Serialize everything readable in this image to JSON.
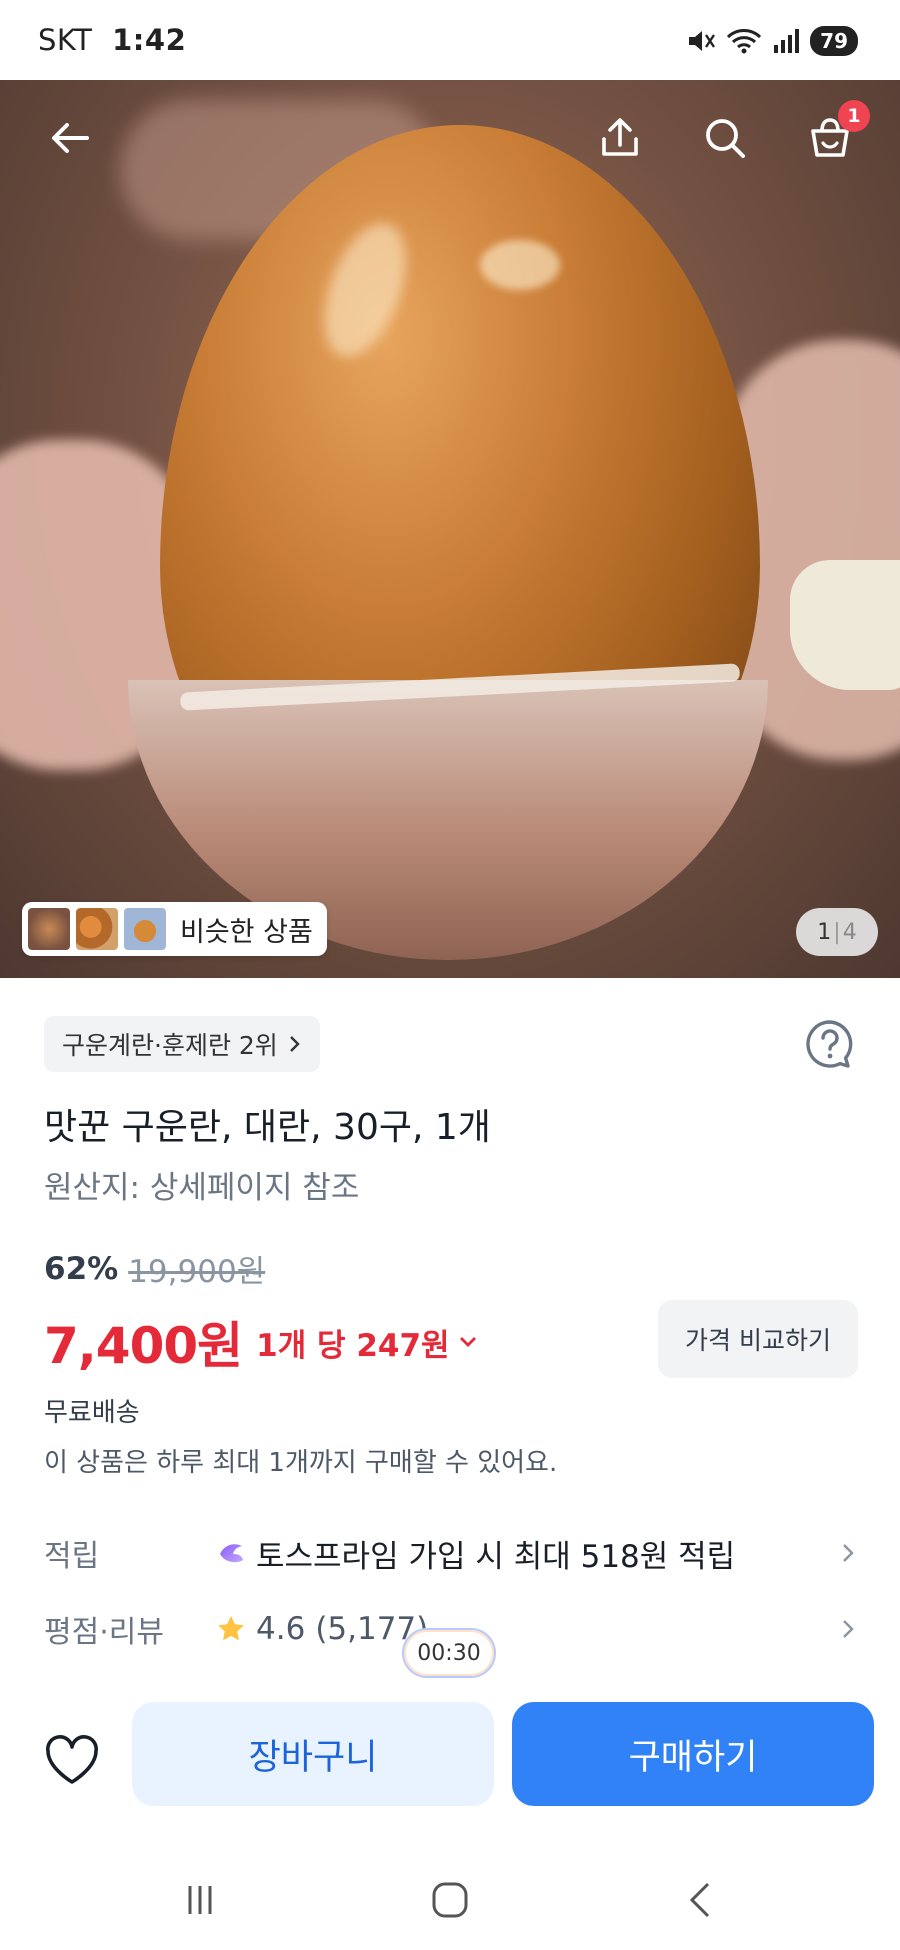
{
  "status": {
    "carrier": "SKT",
    "time": "1:42",
    "battery": "79"
  },
  "gallery": {
    "similar_label": "비슷한 상품",
    "page_current": "1",
    "page_total": "4",
    "cart_count": "1"
  },
  "product": {
    "rank_label": "구운계란·훈제란 2위",
    "title": "맛꾼 구운란, 대란, 30구, 1개",
    "origin": "원산지: 상세페이지 참조",
    "discount": "62%",
    "original_price": "19,900원",
    "price": "7,400원",
    "unit_price": "1개 당 247원",
    "compare_label": "가격 비교하기",
    "shipping": "무료배송",
    "purchase_limit": "이 상품은 하루 최대 1개까지 구매할 수 있어요."
  },
  "rows": {
    "points_label": "적립",
    "points_value": "토스프라임 가입 시 최대 518원 적립",
    "review_label": "평점·리뷰",
    "rating": "4.6",
    "review_count": "(5,177)"
  },
  "timer": "00:30",
  "actions": {
    "cart_label": "장바구니",
    "buy_label": "구매하기"
  },
  "colors": {
    "accent_blue": "#3182f6",
    "price_red": "#e42939",
    "badge_red": "#f04452",
    "star_yellow": "#ffc342"
  },
  "icons": [
    "back-arrow-icon",
    "share-icon",
    "search-icon",
    "cart-icon",
    "help-icon",
    "prime-gem-icon",
    "star-icon",
    "chevron-right-icon",
    "heart-icon",
    "mute-icon",
    "wifi-icon",
    "signal-icon"
  ]
}
